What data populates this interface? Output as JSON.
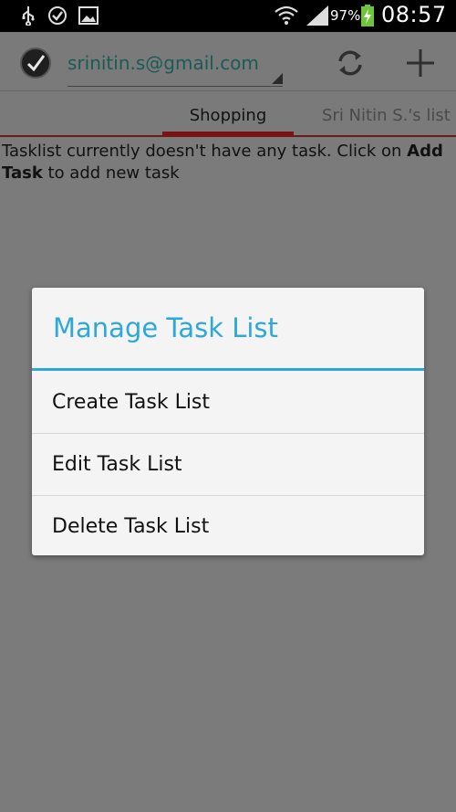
{
  "status_bar": {
    "battery_percent": "97%",
    "time": "08:57",
    "icons": [
      "usb-icon",
      "check-circle-icon",
      "image-icon",
      "wifi-icon",
      "signal-icon",
      "battery-charging-icon"
    ]
  },
  "app_bar": {
    "account_email": "srinitin.s@gmail.com",
    "actions": [
      "refresh-icon",
      "add-icon"
    ]
  },
  "tabs": [
    {
      "label": "Shopping",
      "selected": true
    },
    {
      "label": "Sri Nitin S.'s list",
      "selected": false
    }
  ],
  "content": {
    "message_part1": "Tasklist currently doesn't have any task. Click on ",
    "message_bold": "Add Task",
    "message_part2": " to add new task"
  },
  "dialog": {
    "title": "Manage Task List",
    "items": [
      {
        "label": "Create Task List"
      },
      {
        "label": "Edit Task List"
      },
      {
        "label": "Delete Task List"
      }
    ]
  },
  "colors": {
    "accent": "#2ea8d8",
    "tab_indicator": "#7a1414",
    "account_text": "#1b5b57"
  }
}
